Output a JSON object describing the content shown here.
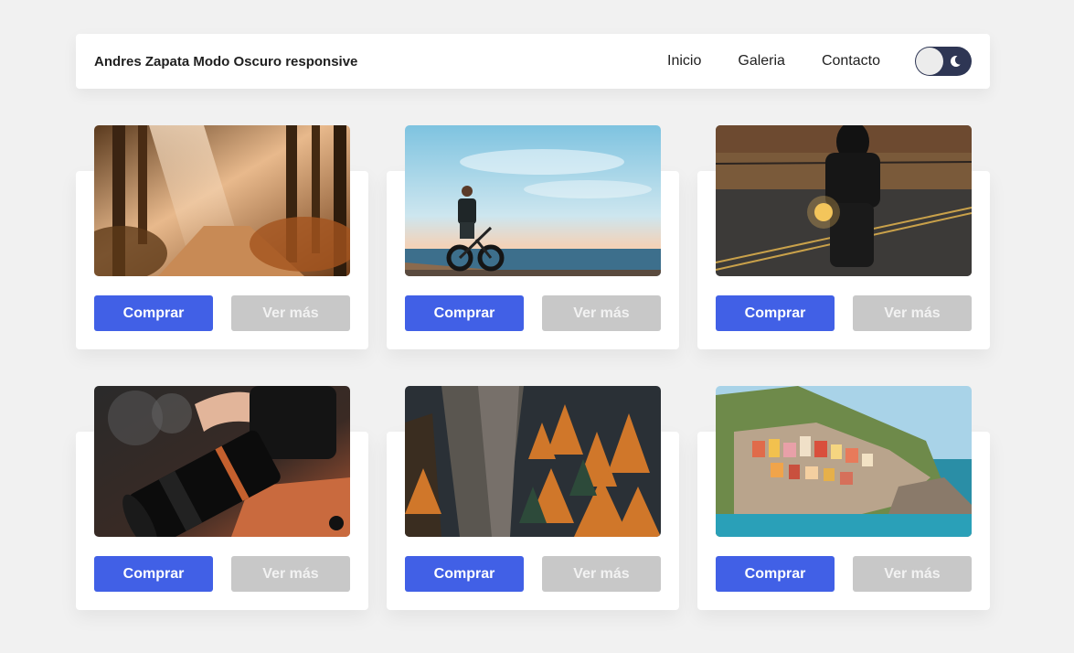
{
  "navbar": {
    "brand": "Andres Zapata Modo Oscuro responsive",
    "links": [
      {
        "label": "Inicio"
      },
      {
        "label": "Galeria"
      },
      {
        "label": "Contacto"
      }
    ],
    "theme_toggle": {
      "icon": "moon-icon",
      "state": "light"
    }
  },
  "cards": [
    {
      "image": "forest-path-photo",
      "buy_label": "Comprar",
      "more_label": "Ver más"
    },
    {
      "image": "cyclist-beach-photo",
      "buy_label": "Comprar",
      "more_label": "Ver más"
    },
    {
      "image": "motorcyclist-road-photo",
      "buy_label": "Comprar",
      "more_label": "Ver más"
    },
    {
      "image": "camera-lens-photo",
      "buy_label": "Comprar",
      "more_label": "Ver más"
    },
    {
      "image": "autumn-cliff-photo",
      "buy_label": "Comprar",
      "more_label": "Ver más"
    },
    {
      "image": "coastal-village-photo",
      "buy_label": "Comprar",
      "more_label": "Ver más"
    }
  ],
  "colors": {
    "background": "#f1f1f1",
    "primary_button": "#4160e6",
    "secondary_button": "#c8c8c8",
    "toggle_track": "#2e3654"
  }
}
